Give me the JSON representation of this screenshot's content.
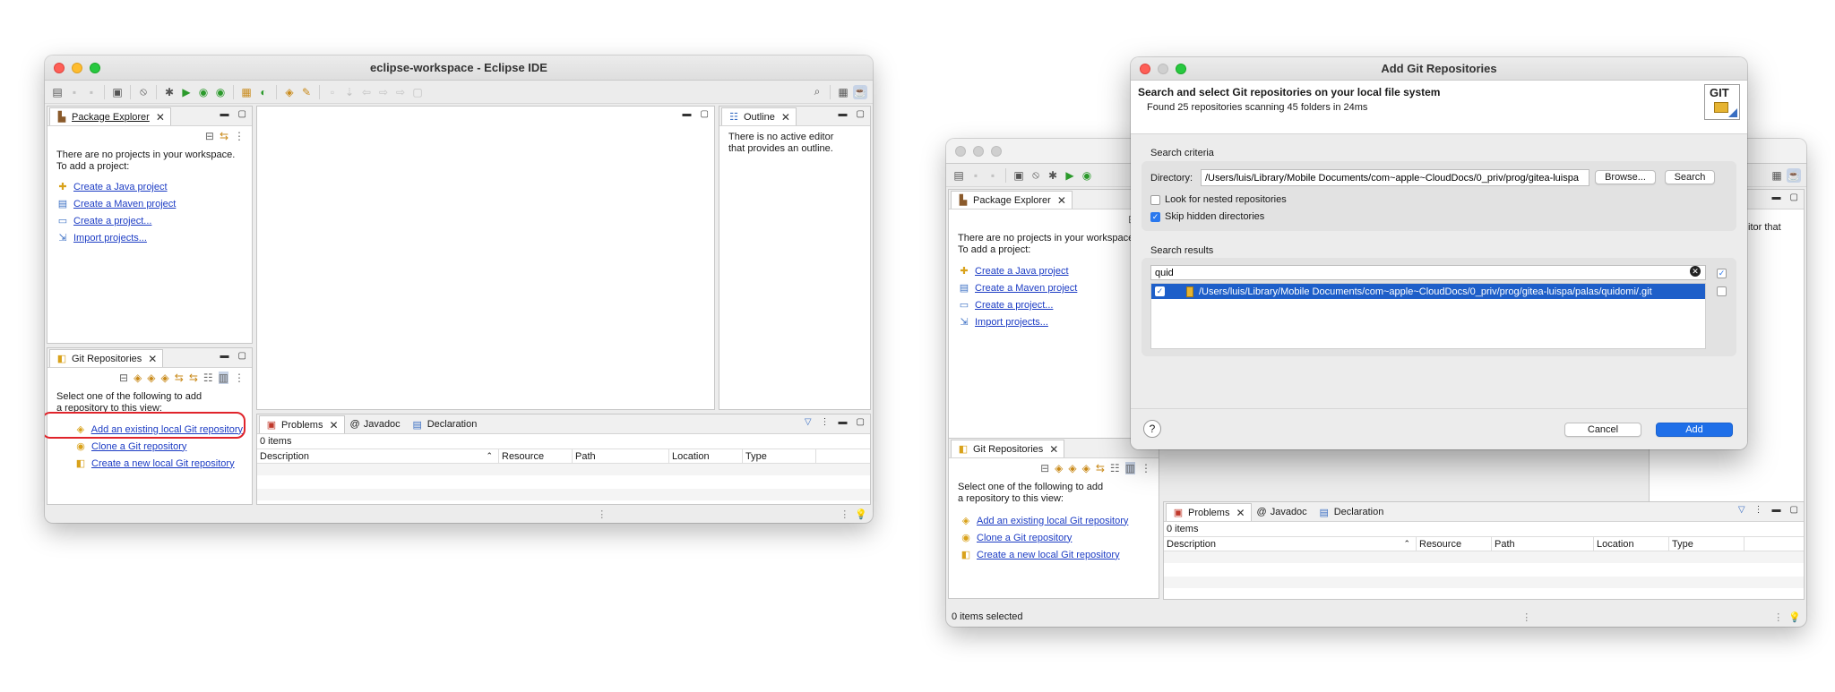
{
  "left_window": {
    "title": "eclipse-workspace - Eclipse IDE",
    "package_explorer": {
      "tab": "Package Explorer",
      "message_line1": "There are no projects in your workspace.",
      "message_line2": "To add a project:",
      "links": [
        "Create a Java project",
        "Create a Maven project",
        "Create a project...",
        "Import projects..."
      ]
    },
    "outline": {
      "tab": "Outline",
      "message": "There is no active editor that provides an outline."
    },
    "git": {
      "tab": "Git Repositories",
      "message": "Select one of the following to add a repository to this view:",
      "links": [
        "Add an existing local Git repository",
        "Clone a Git repository",
        "Create a new local Git repository"
      ]
    },
    "problems": {
      "tabs": [
        "Problems",
        "Javadoc",
        "Declaration"
      ],
      "count": "0 items",
      "columns": [
        "Description",
        "Resource",
        "Path",
        "Location",
        "Type"
      ]
    }
  },
  "right_window": {
    "package_explorer": {
      "tab": "Package Explorer",
      "message_line1": "There are no projects in your workspace",
      "message_line2": "To add a project:",
      "links": [
        "Create a Java project",
        "Create a Maven project",
        "Create a project...",
        "Import projects..."
      ]
    },
    "outline_fragment": "itor that",
    "git": {
      "tab": "Git Repositories",
      "message": "Select one of the following to add a repository to this view:",
      "links": [
        "Add an existing local Git repository",
        "Clone a Git repository",
        "Create a new local Git repository"
      ]
    },
    "problems": {
      "tabs": [
        "Problems",
        "Javadoc",
        "Declaration"
      ],
      "count": "0 items",
      "columns": [
        "Description",
        "Resource",
        "Path",
        "Location",
        "Type"
      ]
    },
    "status": "0 items selected"
  },
  "dialog": {
    "title": "Add Git Repositories",
    "heading": "Search and select Git repositories on your local file system",
    "subheading": "Found 25 repositories scanning 45 folders in 24ms",
    "git_logo": "GIT",
    "criteria_label": "Search criteria",
    "directory_label": "Directory:",
    "directory_value": "/Users/luis/Library/Mobile Documents/com~apple~CloudDocs/0_priv/prog/gitea-luispa",
    "browse": "Browse...",
    "search": "Search",
    "nested_label": "Look for nested repositories",
    "nested_checked": false,
    "hidden_label": "Skip hidden directories",
    "hidden_checked": true,
    "results_label": "Search results",
    "filter_value": "quid",
    "result_path": "/Users/luis/Library/Mobile Documents/com~apple~CloudDocs/0_priv/prog/gitea-luispa/palas/quidomi/.git",
    "result_checked": true,
    "help": "?",
    "cancel": "Cancel",
    "add": "Add"
  },
  "colors": {
    "link": "#1c3cc4",
    "primary": "#1f6fe8",
    "selection": "#1e5fc9",
    "highlight": "#e0242b"
  }
}
